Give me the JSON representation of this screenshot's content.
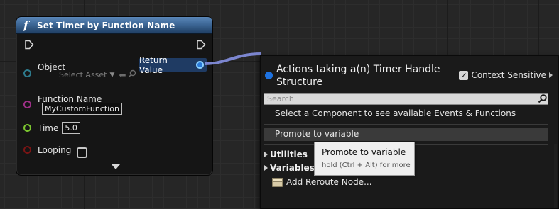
{
  "node": {
    "title": "Set Timer by Function Name",
    "function_icon": "f",
    "pins": {
      "object_label": "Object",
      "object_select_placeholder": "Select Asset",
      "function_name_label": "Function Name",
      "function_name_value": "MyCustomFunction",
      "time_label": "Time",
      "time_value": "5.0",
      "looping_label": "Looping",
      "looping_checked": false,
      "return_value_label": "Return Value"
    },
    "colors": {
      "header": "#3d6796",
      "object_pin": "#2d7a8c",
      "function_name_pin": "#9c2f86",
      "time_pin": "#7bc52f",
      "looping_pin": "#7a1414",
      "return_pin": "#2a7ad8"
    }
  },
  "menu": {
    "title": "Actions taking a(n) Timer Handle Structure",
    "context_sensitive_label": "Context Sensitive",
    "context_sensitive_checked": true,
    "search_placeholder": "Search",
    "info_text": "Select a Component to see available Events & Functions",
    "highlighted_item": "Promote to variable",
    "categories": [
      {
        "label": "Utilities"
      },
      {
        "label": "Variables"
      }
    ],
    "reroute_item": "Add Reroute Node..."
  },
  "tooltip": {
    "title": "Promote to variable",
    "shortcut": "hold (Ctrl + Alt) for more"
  }
}
